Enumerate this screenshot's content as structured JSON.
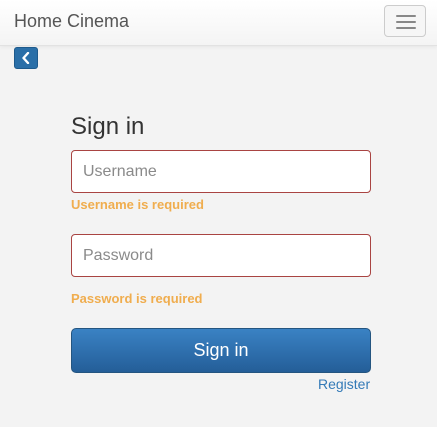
{
  "navbar": {
    "brand": "Home Cinema",
    "toggle_icon": "hamburger-menu-icon"
  },
  "back_button": {
    "icon": "chevron-left-icon",
    "color": "#2a6fa8"
  },
  "form": {
    "title": "Sign in",
    "username": {
      "placeholder": "Username",
      "value": "",
      "error": "Username is required"
    },
    "password": {
      "placeholder": "Password",
      "value": "",
      "error": "Password is required"
    },
    "submit_label": "Sign in",
    "register_label": "Register"
  },
  "colors": {
    "error_text": "#f0ad4e",
    "error_border": "#a94442",
    "primary": "#2a6fa8",
    "link": "#337ab7"
  }
}
